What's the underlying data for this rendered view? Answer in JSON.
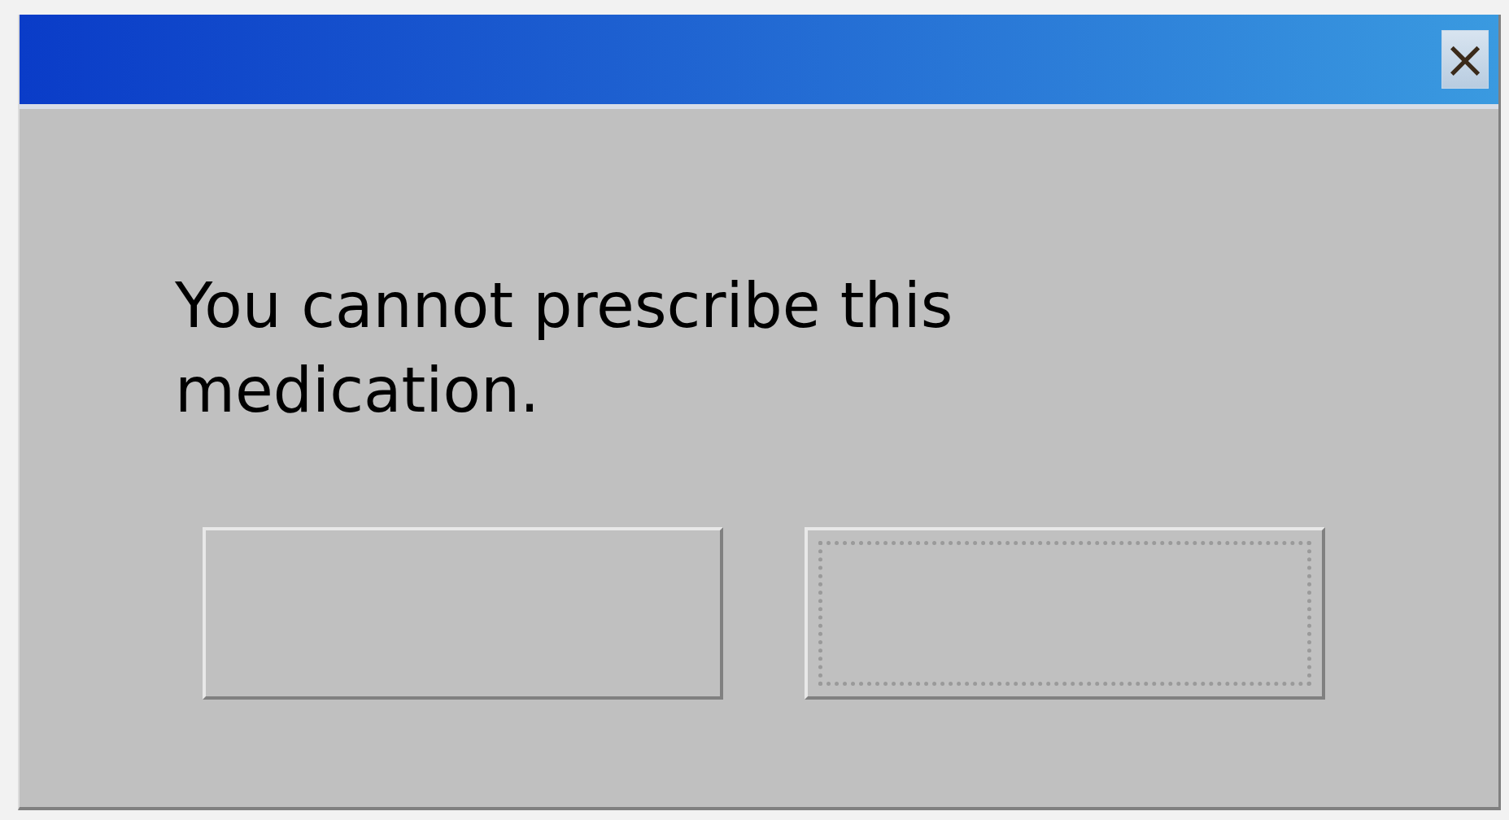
{
  "dialog": {
    "message": "You cannot prescribe this medication.",
    "close_button": {
      "label": "×"
    },
    "buttons": [
      {
        "focused": false
      },
      {
        "focused": true
      }
    ]
  }
}
